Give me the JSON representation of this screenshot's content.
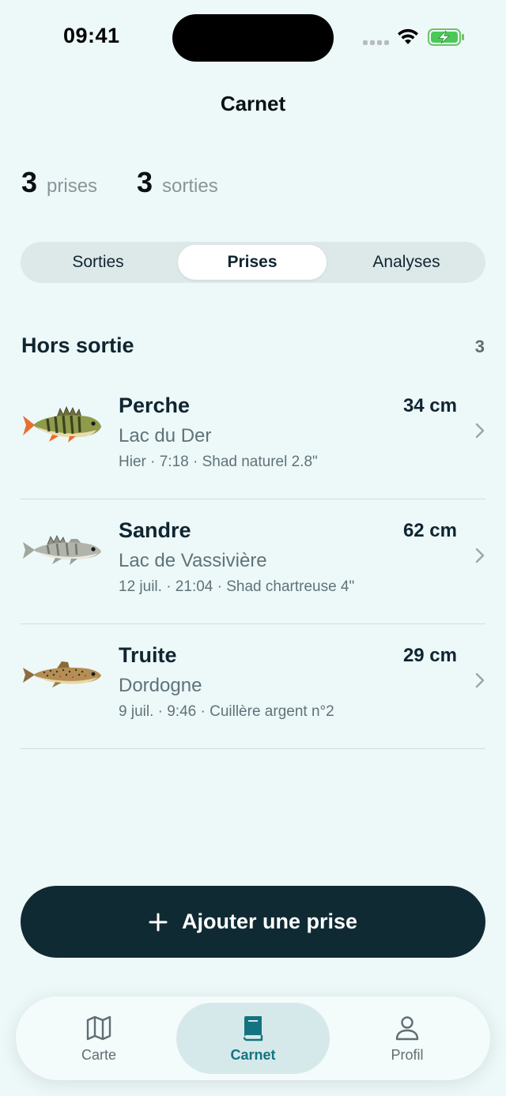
{
  "status_bar": {
    "time": "09:41"
  },
  "header": {
    "title": "Carnet"
  },
  "stats": [
    {
      "value": "3",
      "label": "prises"
    },
    {
      "value": "3",
      "label": "sorties"
    }
  ],
  "segments": [
    {
      "label": "Sorties",
      "active": false
    },
    {
      "label": "Prises",
      "active": true
    },
    {
      "label": "Analyses",
      "active": false
    }
  ],
  "section": {
    "title": "Hors sortie",
    "count": "3"
  },
  "catches": [
    {
      "species": "Perche",
      "size": "34 cm",
      "place": "Lac du Der",
      "meta": "Hier · 7:18 · Shad naturel 2.8\"",
      "icon": "perch-fish-icon"
    },
    {
      "species": "Sandre",
      "size": "62 cm",
      "place": "Lac de Vassivière",
      "meta": "12 juil. · 21:04 · Shad chartreuse 4\"",
      "icon": "zander-fish-icon"
    },
    {
      "species": "Truite",
      "size": "29 cm",
      "place": "Dordogne",
      "meta": "9 juil. · 9:46 · Cuillère argent n°2",
      "icon": "trout-fish-icon"
    }
  ],
  "add_button": {
    "label": "Ajouter une prise",
    "icon": "plus-icon"
  },
  "tabbar": [
    {
      "label": "Carte",
      "icon": "map-icon",
      "active": false
    },
    {
      "label": "Carnet",
      "icon": "book-icon",
      "active": true
    },
    {
      "label": "Profil",
      "icon": "person-icon",
      "active": false
    }
  ],
  "colors": {
    "background": "#edf8f8",
    "dark": "#0f2a33",
    "accent": "#137381"
  }
}
